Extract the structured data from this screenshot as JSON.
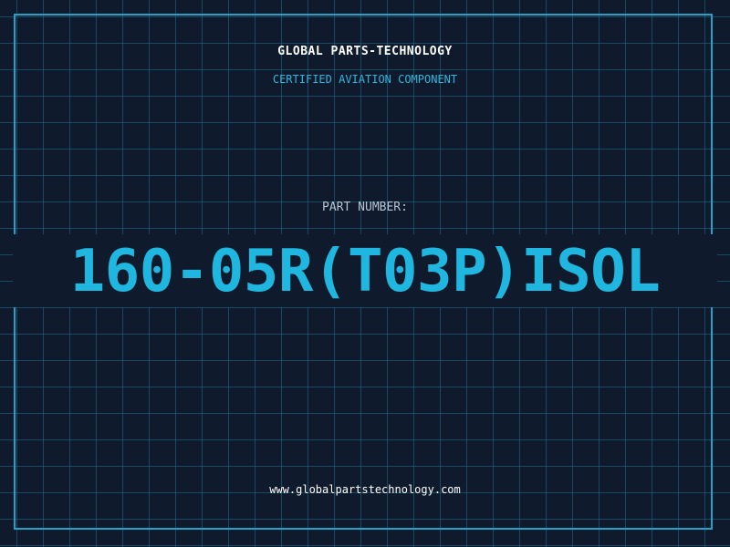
{
  "header": {
    "company": "GLOBAL PARTS-TECHNOLOGY",
    "subtitle": "CERTIFIED AVIATION COMPONENT"
  },
  "part": {
    "label": "PART NUMBER:",
    "number": "160-05R(T03P)ISOL"
  },
  "footer": {
    "url": "www.globalpartstechnology.com"
  },
  "colors": {
    "background": "#0f1b2d",
    "grid": "#1f6f8b",
    "frame": "#21a3c9",
    "accent": "#1fb7e0",
    "label": "#b8c4d2",
    "text": "#ffffff"
  }
}
